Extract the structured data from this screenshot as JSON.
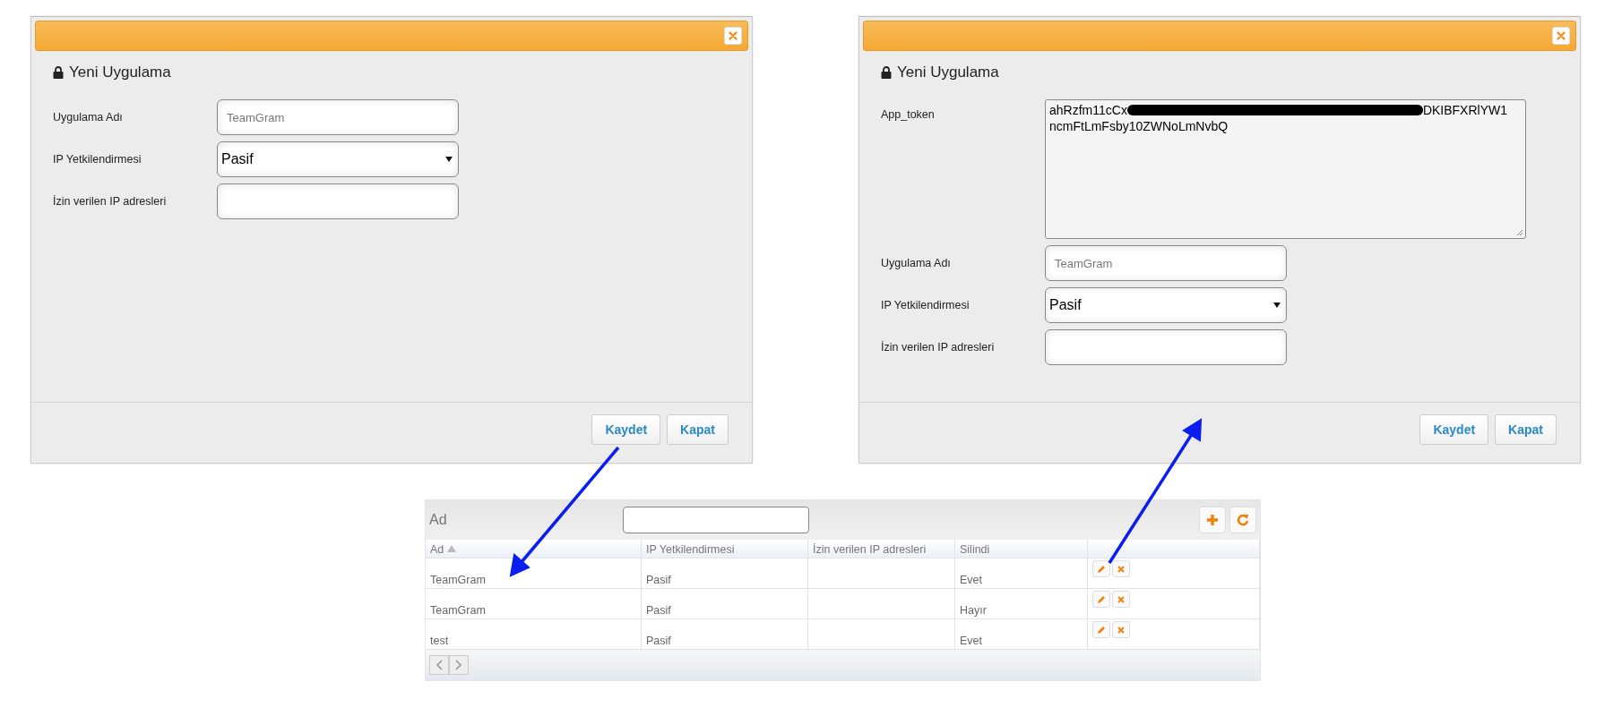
{
  "dialogs": [
    {
      "title": "Yeni Uygulama",
      "fields": [
        {
          "kind": "input",
          "label": "Uygulama Adı",
          "placeholder": "TeamGram"
        },
        {
          "kind": "select",
          "label": "IP Yetkilendirmesi",
          "value": "Pasif"
        },
        {
          "kind": "input",
          "label": "İzin verilen IP adresleri"
        }
      ],
      "buttons": [
        "Kaydet",
        "Kapat"
      ]
    },
    {
      "title": "Yeni Uygulama",
      "fields": [
        {
          "kind": "token",
          "label": "App_token",
          "value_start": "ahRzfm11cCx",
          "value_end": "DKIBFXRlYW1",
          "value_line_2": "ncmFtLmFsby10ZWNoLmNvbQ"
        },
        {
          "kind": "input",
          "label": "Uygulama Adı",
          "placeholder": "TeamGram"
        },
        {
          "kind": "select",
          "label": "IP Yetkilendirmesi",
          "value": "Pasif"
        },
        {
          "kind": "input",
          "label": "İzin verilen IP adresleri"
        }
      ],
      "buttons": [
        "Kaydet",
        "Kapat"
      ]
    }
  ],
  "table": {
    "title": "Ad",
    "columns": [
      {
        "label": "Ad",
        "sorted": true
      },
      {
        "label": "IP Yetkilendirmesi",
        "sorted": false
      },
      {
        "label": "İzin verilen IP adresleri",
        "sorted": false
      },
      {
        "label": "Silindi",
        "sorted": false
      }
    ],
    "rows": [
      {
        "ad": "TeamGram",
        "ip_yetkilendirmesi": "Pasif",
        "silindi": "Evet"
      },
      {
        "ad": "TeamGram",
        "ip_yetkilendirmesi": "Pasif",
        "silindi": "Hayır"
      },
      {
        "ad": "test",
        "ip_yetkilendirmesi": "Pasif",
        "silindi": "Evet"
      }
    ]
  }
}
